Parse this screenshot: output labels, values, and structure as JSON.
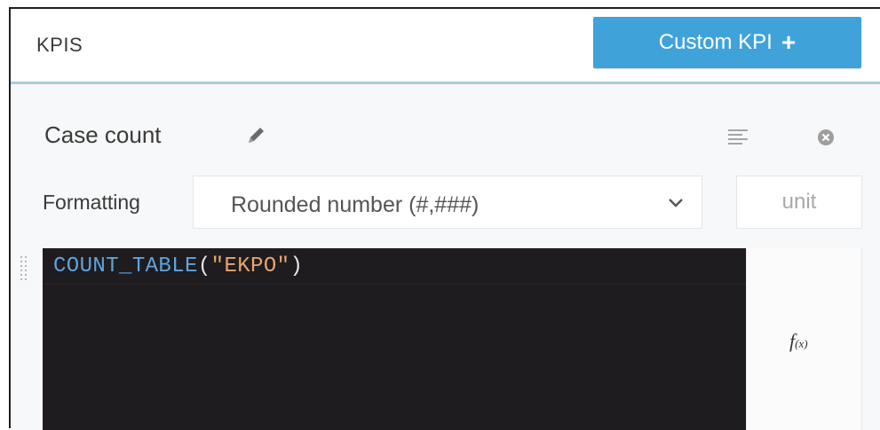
{
  "header": {
    "title": "KPIS",
    "custom_kpi_label": "Custom KPI",
    "custom_kpi_icon": "plus-icon"
  },
  "kpi": {
    "name": "Case count",
    "edit_icon": "pencil-icon",
    "menu_icon": "menu-icon",
    "remove_icon": "close-icon"
  },
  "formatting": {
    "label": "Formatting",
    "selected": "Rounded number (#,###)",
    "unit_placeholder": "unit",
    "unit_value": ""
  },
  "editor": {
    "fn": "COUNT_TABLE",
    "open": "(",
    "arg": "\"EKPO\"",
    "close": ")",
    "function_button": "f(x)"
  },
  "colors": {
    "accent": "#3fa3da",
    "editor_bg": "#1e1c1e",
    "code_function": "#5fa4e0",
    "code_string": "#e8a56e"
  }
}
